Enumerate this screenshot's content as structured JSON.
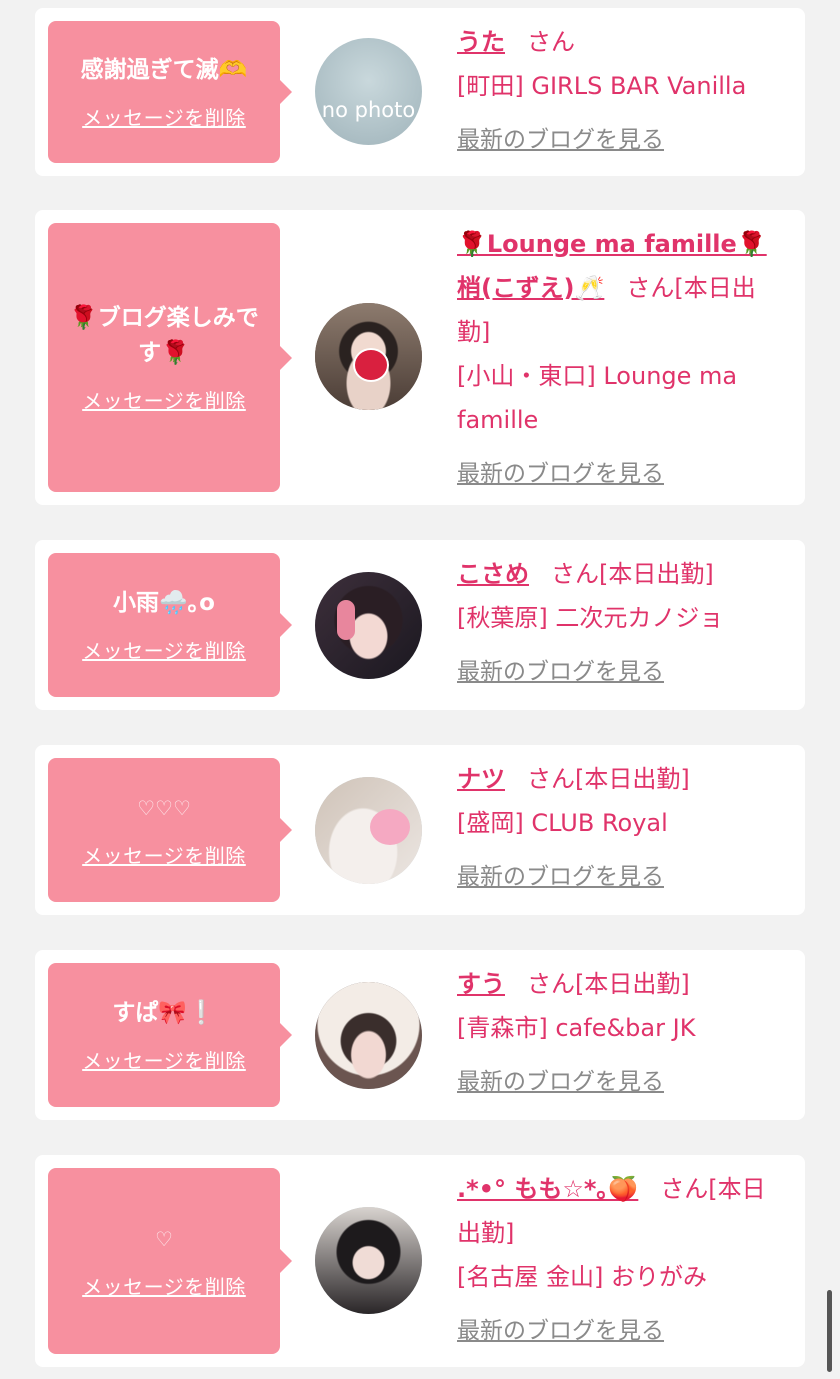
{
  "cards": [
    {
      "message": "感謝過ぎて滅🫶",
      "delete_label": "メッセージを削除",
      "name": "うた",
      "suffix": "さん",
      "shop": "[町田] GIRLS BAR Vanilla",
      "blog_label": "最新のブログを見る",
      "avatar_text": "no photo"
    },
    {
      "message": "🌹ブログ楽しみです🌹",
      "delete_label": "メッセージを削除",
      "name": "🌹Lounge ma famille🌹梢(こずえ)🥂",
      "suffix": "さん[本日出勤]",
      "shop": "[小山・東口] Lounge ma famille",
      "blog_label": "最新のブログを見る"
    },
    {
      "message": "小雨🌧️｡o",
      "delete_label": "メッセージを削除",
      "name": "こさめ",
      "suffix": "さん[本日出勤]",
      "shop": "[秋葉原] 二次元カノジョ",
      "blog_label": "最新のブログを見る"
    },
    {
      "message": "♡♡♡",
      "delete_label": "メッセージを削除",
      "name": "ナツ",
      "suffix": "さん[本日出勤]",
      "shop": "[盛岡] CLUB Royal",
      "blog_label": "最新のブログを見る"
    },
    {
      "message": "すぱ🎀❕",
      "delete_label": "メッセージを削除",
      "name": "すう",
      "suffix": "さん[本日出勤]",
      "shop": "[青森市] cafe&bar JK",
      "blog_label": "最新のブログを見る"
    },
    {
      "message": "♡",
      "delete_label": "メッセージを削除",
      "name": ".*•° もも☆*｡🍑",
      "suffix": "さん[本日出勤]",
      "shop": "[名古屋 金山] おりがみ",
      "blog_label": "最新のブログを見る"
    }
  ],
  "colors": {
    "bubble": "#f7909f",
    "accent": "#e0336a",
    "link_gray": "#8a8a8a",
    "background": "#f2f2f2"
  }
}
